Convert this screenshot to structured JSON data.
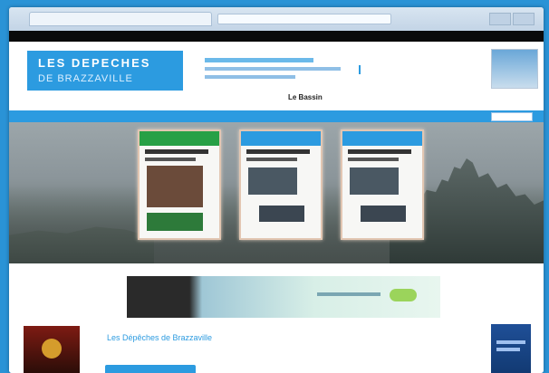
{
  "brand": {
    "line1": "LES DEPECHES",
    "line2": "DE BRAZZAVILLE"
  },
  "header": {
    "center_title": "Le Bassin",
    "left_link": "",
    "right_link": ""
  },
  "subnav": {
    "item": ""
  },
  "content": {
    "blurb_title": "Les Dépêches de Brazzaville"
  },
  "colors": {
    "accent": "#2c9be0",
    "page_bg": "#ffffff",
    "desktop": "#2a93d6"
  },
  "icons": {
    "search": "search-icon"
  }
}
